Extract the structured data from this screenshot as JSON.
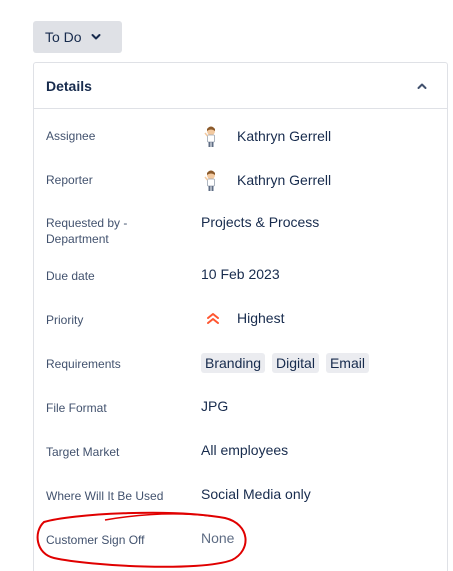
{
  "status": {
    "label": "To Do",
    "icon": "chevron-down-icon"
  },
  "details": {
    "title": "Details",
    "collapse_icon": "chevron-up-icon",
    "fields": {
      "assignee": {
        "label": "Assignee",
        "value": "Kathryn Gerrell"
      },
      "reporter": {
        "label": "Reporter",
        "value": "Kathryn Gerrell"
      },
      "requested_by": {
        "label_line1": "Requested by -",
        "label_line2": "Department",
        "value": "Projects & Process"
      },
      "due_date": {
        "label": "Due date",
        "value": "10 Feb 2023"
      },
      "priority": {
        "label": "Priority",
        "value": "Highest",
        "color": "#ff5630"
      },
      "requirements": {
        "label": "Requirements",
        "tags": [
          "Branding",
          "Digital",
          "Email"
        ]
      },
      "file_format": {
        "label": "File Format",
        "value": "JPG"
      },
      "target_market": {
        "label": "Target Market",
        "value": "All employees"
      },
      "where_used": {
        "label": "Where Will It Be Used",
        "value": "Social Media only"
      },
      "customer_sign_off": {
        "label": "Customer Sign Off",
        "value": "None"
      }
    }
  },
  "annotation": {
    "color": "#e00000"
  }
}
